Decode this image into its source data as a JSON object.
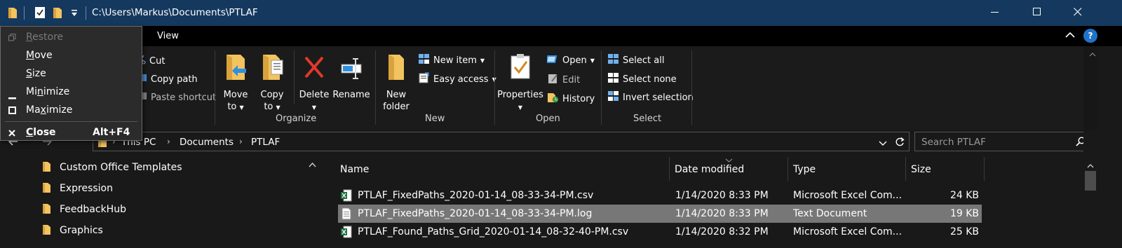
{
  "title_bar": {
    "path": "C:\\Users\\Markus\\Documents\\PTLAF",
    "quick_access_icons": [
      "folder-icon",
      "properties-check-icon",
      "new-folder-icon",
      "customize-dropdown-icon"
    ],
    "window_buttons": [
      "minimize-icon",
      "maximize-icon",
      "close-icon"
    ]
  },
  "ribbon_tabs": {
    "tabs": [
      "View"
    ]
  },
  "ribbon": {
    "clipboard": {
      "cut": "Cut",
      "copy_path": "Copy path",
      "paste_shortcut": "Paste shortcut"
    },
    "organize": {
      "label": "Organize",
      "move_to_1": "Move",
      "move_to_2": "to",
      "copy_to_1": "Copy",
      "copy_to_2": "to",
      "delete": "Delete",
      "rename": "Rename"
    },
    "new": {
      "label": "New",
      "new_folder_1": "New",
      "new_folder_2": "folder",
      "new_item": "New item",
      "easy_access": "Easy access"
    },
    "open": {
      "label": "Open",
      "properties": "Properties",
      "open": "Open",
      "edit": "Edit",
      "history": "History"
    },
    "select": {
      "label": "Select",
      "select_all": "Select all",
      "select_none": "Select none",
      "invert_selection": "Invert selection"
    }
  },
  "address_bar": {
    "crumbs": [
      "This PC",
      "Documents",
      "PTLAF"
    ],
    "search_placeholder": "Search PTLAF"
  },
  "nav_pane": {
    "items": [
      "Custom Office Templates",
      "Expression",
      "FeedbackHub",
      "Graphics"
    ]
  },
  "file_list": {
    "columns": [
      "Name",
      "Date modified",
      "Type",
      "Size"
    ],
    "rows": [
      {
        "name": "PTLAF_FixedPaths_2020-01-14_08-33-34-PM.csv",
        "date": "1/14/2020 8:33 PM",
        "type": "Microsoft Excel Com...",
        "size": "24 KB",
        "icon": "excel-csv-icon",
        "selected": false
      },
      {
        "name": "PTLAF_FixedPaths_2020-01-14_08-33-34-PM.log",
        "date": "1/14/2020 8:33 PM",
        "type": "Text Document",
        "size": "19 KB",
        "icon": "text-document-icon",
        "selected": true
      },
      {
        "name": "PTLAF_Found_Paths_Grid_2020-01-14_08-32-40-PM.csv",
        "date": "1/14/2020 8:32 PM",
        "type": "Microsoft Excel Com...",
        "size": "25 KB",
        "icon": "excel-csv-icon",
        "selected": false
      }
    ]
  },
  "system_menu": {
    "items": [
      {
        "label": "Restore",
        "mnemonic": "R",
        "rest": "estore",
        "disabled": true
      },
      {
        "label": "Move",
        "mnemonic": "M",
        "rest": "ove",
        "disabled": false
      },
      {
        "label": "Size",
        "mnemonic": "S",
        "rest": "ize",
        "disabled": false
      },
      {
        "label": "Minimize",
        "mnemonic": "n",
        "rest_before": "Mi",
        "rest": "imize",
        "disabled": false
      },
      {
        "label": "Maximize",
        "mnemonic": "x",
        "rest_before": "Ma",
        "rest": "imize",
        "disabled": false
      },
      {
        "label": "Close",
        "mnemonic": "C",
        "rest": "lose",
        "accelerator": "Alt+F4",
        "disabled": false
      }
    ]
  },
  "colors": {
    "title_bar": "#15395e",
    "background": "#191919",
    "selected_row": "#777777",
    "help_button": "#1f73c9"
  }
}
